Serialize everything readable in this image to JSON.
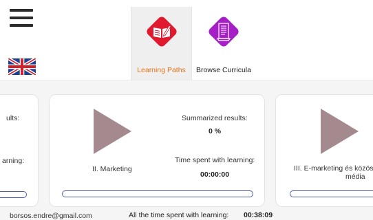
{
  "nav": {
    "tabs": [
      {
        "label": "Learning Paths",
        "active": true,
        "icon": "open-book-pencil-icon",
        "icon_color": "#e0192e"
      },
      {
        "label": "Browse Curricula",
        "active": false,
        "icon": "document-scroll-icon",
        "icon_color": "#a51ec6"
      }
    ],
    "accent_color": "#e8731a",
    "language_icon": "uk-flag-icon"
  },
  "cards": [
    {
      "results_label_partial": "ults:",
      "time_label_partial": "arning:",
      "progress": 0
    },
    {
      "title": "II. Marketing",
      "results_label": "Summarized results:",
      "results_value": "0 %",
      "time_label": "Time spent with learning:",
      "time_value": "00:00:00",
      "progress": 0
    },
    {
      "title_line1": "III. E-marketing és közöss",
      "title_line2": "média",
      "progress": 0
    }
  ],
  "footer": {
    "email": "borsos.endre@gmail.com",
    "total_time_label": "All the time spent with learning:",
    "total_time_value": "00:38:09"
  },
  "colors": {
    "play": "#a48a8f",
    "progress_border": "#4d5aa8"
  }
}
